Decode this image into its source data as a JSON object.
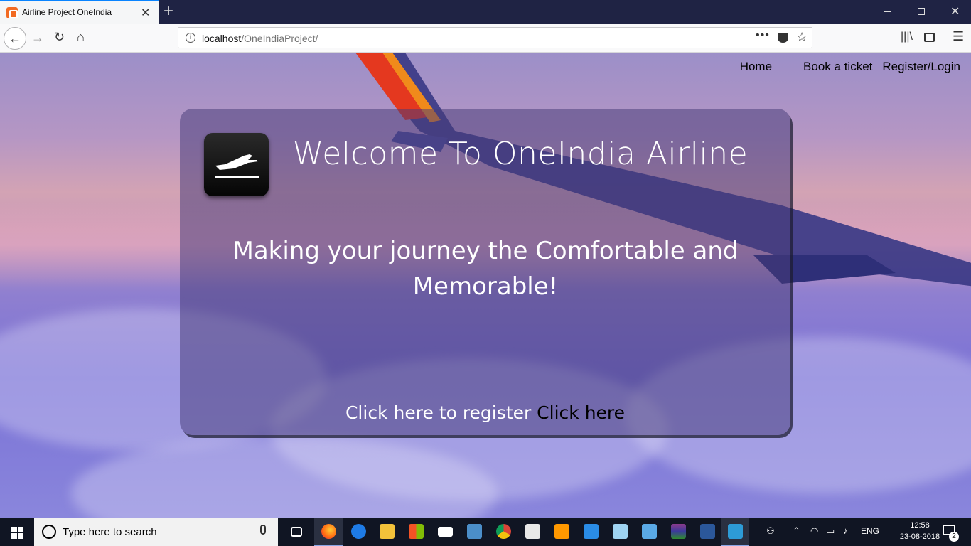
{
  "browser": {
    "tab_title": "Airline Project OneIndia",
    "url_host": "localhost",
    "url_path": "/OneIndiaProject/"
  },
  "site": {
    "nav": {
      "home": "Home",
      "book": "Book a ticket",
      "register": "Register/Login"
    },
    "title": "Welcome To OneIndia Airline",
    "tagline": "Making your journey the Comfortable and Memorable!",
    "cta_text": "Click here to register ",
    "cta_link": "Click here"
  },
  "taskbar": {
    "search_placeholder": "Type here to search",
    "language": "ENG",
    "time": "12:58",
    "date": "23-08-2018",
    "notification_count": "2",
    "apps": [
      "task-view-icon",
      "firefox-icon",
      "edge-icon",
      "file-explorer-icon",
      "store-icon",
      "mail-icon",
      "vmware-icon",
      "chrome-icon",
      "notepad-icon",
      "sublime-icon",
      "vscode-icon",
      "app-icon",
      "control-panel-icon",
      "winrar-icon",
      "word-icon",
      "brackets-icon"
    ]
  },
  "colors": {
    "accent": "#0a84ff",
    "card_overlay": "#463c78",
    "cta_link": "#000000"
  }
}
